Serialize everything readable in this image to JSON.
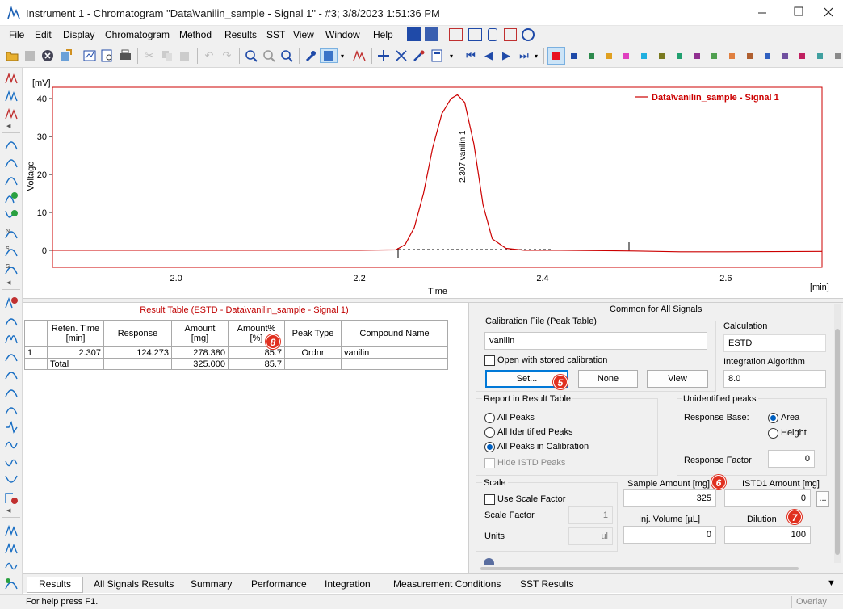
{
  "window": {
    "title": "Instrument 1 - Chromatogram \"Data\\vanilin_sample - Signal 1\" - #3;   3/8/2023    1:51:36 PM",
    "app_icon": "instrument-icon"
  },
  "menu": [
    "File",
    "Edit",
    "Display",
    "Chromatogram",
    "Method",
    "Results",
    "SST",
    "View",
    "Window",
    "Help"
  ],
  "toolbar": {
    "swatch_colors": [
      "#e81123",
      "#1f4aa8",
      "#2d8a4d",
      "#e0a020",
      "#e040c0",
      "#20b0e0",
      "#7a7a20",
      "#22a070",
      "#903090",
      "#50a050",
      "#e08040",
      "#b06030",
      "#3060c0",
      "#7050a0",
      "#c02060",
      "#40a0a0",
      "#8a8a8a",
      "#707030"
    ]
  },
  "chart": {
    "y_unit": "[mV]",
    "y_label": "Voltage",
    "x_label": "Time",
    "x_unit": "[min]",
    "legend": "Data\\vanilin_sample - Signal 1",
    "peak_label": "2.307 vanilin   1",
    "line_color": "#cc0000"
  },
  "chart_data": {
    "type": "line",
    "title": "",
    "xlabel": "Time",
    "ylabel": "Voltage",
    "x_unit": "min",
    "y_unit": "mV",
    "xlim": [
      1.865,
      2.705
    ],
    "ylim": [
      -4.5,
      43
    ],
    "x_ticks": [
      "2.0",
      "2.2",
      "2.4",
      "2.6"
    ],
    "y_ticks": [
      "0",
      "10",
      "20",
      "30",
      "40"
    ],
    "grid": false,
    "legend_position": "top-right",
    "series": [
      {
        "name": "Data\\vanilin_sample - Signal 1",
        "color": "#cc0000",
        "x": [
          1.865,
          2.2,
          2.24,
          2.25,
          2.26,
          2.27,
          2.28,
          2.29,
          2.3,
          2.307,
          2.315,
          2.325,
          2.335,
          2.345,
          2.36,
          2.38,
          2.42,
          2.5,
          2.55,
          2.6,
          2.705
        ],
        "y": [
          0,
          0,
          0.1,
          1.5,
          6,
          15,
          27,
          36,
          40,
          41,
          39,
          28,
          12,
          3,
          0.5,
          0,
          0,
          -0.2,
          -0.4,
          -0.4,
          -0.3
        ]
      }
    ],
    "annotations": [
      {
        "text": "2.307 vanilin   1",
        "x": 2.307
      }
    ]
  },
  "results": {
    "title": "Result Table (ESTD - Data\\vanilin_sample - Signal 1)",
    "headers": [
      "",
      "Reten. Time\n[min]",
      "Response",
      "Amount\n[mg]",
      "Amount%\n[%]",
      "Peak Type",
      "Compound Name"
    ],
    "rows": [
      [
        "1",
        "2.307",
        "124.273",
        "278.380",
        "85.7",
        "Ordnr",
        "vanilin"
      ],
      [
        "",
        "Total",
        "",
        "325.000",
        "85.7",
        "",
        ""
      ]
    ]
  },
  "panel": {
    "common_title": "Common for All Signals",
    "calib_group": "Calibration File (Peak Table)",
    "calib_file": "vanilin",
    "open_stored": "Open with stored calibration",
    "set_btn": "Set...",
    "none_btn": "None",
    "view_btn": "View",
    "calc_label": "Calculation",
    "calc_value": "ESTD",
    "integ_label": "Integration Algorithm",
    "integ_value": "8.0",
    "report_group": "Report in Result Table",
    "all_peaks": "All Peaks",
    "all_identified": "All Identified Peaks",
    "all_in_calib": "All Peaks in Calibration",
    "hide_istd": "Hide ISTD Peaks",
    "unident_group": "Unidentified peaks",
    "response_base": "Response Base:",
    "area": "Area",
    "height": "Height",
    "response_factor": "Response Factor",
    "response_factor_value": "0",
    "scale_group": "Scale",
    "use_scale": "Use Scale Factor",
    "scale_factor": "Scale Factor",
    "scale_factor_value": "1",
    "units": "Units",
    "units_value": "ul",
    "sample_amount": "Sample Amount [mg]",
    "sample_amount_value": "325",
    "istd_amount": "ISTD1 Amount [mg]",
    "istd_amount_value": "0",
    "inj_volume": "Inj. Volume [µL]",
    "inj_volume_value": "0",
    "dilution": "Dilution",
    "dilution_value": "100",
    "more_btn": "..."
  },
  "badges": {
    "b5": "5",
    "b6": "6",
    "b7": "7",
    "b8": "8"
  },
  "tabs": [
    "Results",
    "All Signals Results",
    "Summary",
    "Performance",
    "Integration",
    "Measurement Conditions",
    "SST Results"
  ],
  "status": {
    "help": "For help press F1.",
    "overlay": "Overlay"
  }
}
